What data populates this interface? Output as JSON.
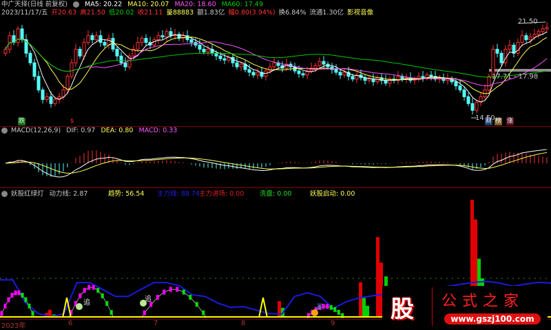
{
  "header": {
    "title": "中广天择(日线 前复权)",
    "ma5": "MA5: 20.22",
    "ma10": "MA10: 20.07",
    "ma20": "MA20: 18.60",
    "ma60": "MA60: 17.49",
    "date": "2023/11/17/五",
    "open": "开20.63",
    "high": "高21.50",
    "low": "低20.02",
    "close": "收21.11",
    "volume": "量88883",
    "amount": "额1.83亿",
    "change": "幅0.80(3.94%)",
    "turnover": "换6.84%",
    "float": "流通1.30亿",
    "sector": "影视音像"
  },
  "price_pane": {
    "high_label": "21.50",
    "low_label": "14.50",
    "range_label": "17.71 - 17.98",
    "badges": [
      "财",
      "榜",
      "涨"
    ],
    "left_badge": "跌",
    "dollar_badge": "$"
  },
  "macd": {
    "label": "MACD(12,26,9)",
    "dif": "DIF: 0.97",
    "dea": "DEA: 0.80",
    "macd": "MACD: 0.33"
  },
  "indicator": {
    "name": "妖股红绿灯",
    "power": "动力线: 2.87",
    "trend": "趋势: 56.54",
    "main": "主力线: 88.74",
    "main_in": "主力进场: 0.00",
    "wash": "洗盘: 0.00",
    "start": "妖股启动: 0.00",
    "chase_labels": [
      "追",
      "追"
    ],
    "buy_label": "买"
  },
  "axis": {
    "months": [
      "2023年",
      "6",
      "7",
      "8",
      "9"
    ]
  },
  "watermark": {
    "logo": "股",
    "title": "公式之家",
    "url": "www.gszj100.com"
  },
  "colors": {
    "up": "#ff3232",
    "down": "#54fcfc",
    "ma5": "#ffffff",
    "ma10": "#ffff54",
    "ma20": "#ff54ff",
    "ma60": "#00c800"
  },
  "chart_data": {
    "type": "candlestick",
    "closes": [
      19.5,
      20.5,
      20,
      21,
      20.2,
      19.2,
      18.5,
      17.5,
      16.5,
      15.8,
      16,
      15.5,
      15.8,
      16,
      16.5,
      17.5,
      18.5,
      19.5,
      19,
      20,
      20.5,
      20.2,
      20.5,
      20,
      19.8,
      20.3,
      19.5,
      19,
      18.5,
      18.2,
      19,
      19.5,
      20,
      20.3,
      20,
      19.8,
      20.2,
      20.5,
      20.4,
      20.8,
      20.5,
      20.6,
      20.3,
      20.5,
      20.2,
      20,
      19.8,
      19.5,
      19.3,
      19.5,
      19.2,
      19,
      18.8,
      18.7,
      18.9,
      18.5,
      18.2,
      18.4,
      18,
      17.8,
      17.6,
      17.8,
      17.5,
      17.9,
      18.2,
      18.5,
      18.3,
      18.1,
      18.4,
      18.2,
      17.9,
      17.7,
      17.6,
      17.9,
      18.1,
      18.3,
      18.6,
      18.4,
      18.2,
      18,
      17.8,
      17.6,
      17.8,
      17.5,
      17.3,
      17.6,
      17.4,
      17.2,
      17.3,
      17.1,
      17.4,
      17.2,
      17,
      17.3,
      17.2,
      17.5,
      17.3,
      17.4,
      17.2,
      17.3,
      17.5,
      17.4,
      17.6,
      17.5,
      17.3,
      17.4,
      17.2,
      17.3,
      17.1,
      16.8,
      16.5,
      16,
      15.5,
      15,
      15.6,
      16,
      16.5,
      17.5,
      19.5,
      19.2,
      18.5,
      19.5,
      19.8,
      19.2,
      20,
      20.5,
      20.2,
      20.4,
      20.6,
      20.8,
      21,
      21.1
    ],
    "price_range": [
      14.5,
      21.5
    ],
    "indicator_main_line": [
      96,
      96,
      37,
      10,
      2,
      10,
      89,
      89,
      72,
      54,
      54,
      72,
      89,
      89,
      81,
      58,
      54,
      37,
      26,
      28,
      19,
      10,
      9,
      54,
      63,
      54,
      23,
      40,
      50,
      55,
      60,
      62,
      65,
      70,
      75,
      80,
      85,
      90,
      92,
      88,
      80,
      85,
      90,
      88
    ],
    "indicator_arcs": [
      {
        "start": 0,
        "end": 50,
        "peak": 63
      },
      {
        "start": 100,
        "end": 165,
        "peak": 77
      },
      {
        "start": 205,
        "end": 300,
        "peak": 72
      },
      {
        "start": 445,
        "end": 500,
        "peak": 28
      }
    ],
    "indicator_spikes": [
      {
        "at": 97,
        "value": 51
      },
      {
        "at": 382,
        "value": 51
      }
    ],
    "indicator_red_bars": [
      {
        "at": 67,
        "value": 12
      },
      {
        "at": 72,
        "value": 20
      },
      {
        "at": 405,
        "value": 42
      },
      {
        "at": 523,
        "value": 90
      },
      {
        "at": 548,
        "value": 205
      },
      {
        "at": 553,
        "value": 140
      },
      {
        "at": 685,
        "value": 300
      },
      {
        "at": 690,
        "value": 250
      }
    ],
    "indicator_green_bars": [
      {
        "at": 78,
        "value": 8
      },
      {
        "at": 410,
        "value": 25
      },
      {
        "at": 528,
        "value": 50
      },
      {
        "at": 533,
        "value": 30
      },
      {
        "at": 560,
        "value": 105
      },
      {
        "at": 695,
        "value": 150
      },
      {
        "at": 700,
        "value": 100
      }
    ]
  }
}
